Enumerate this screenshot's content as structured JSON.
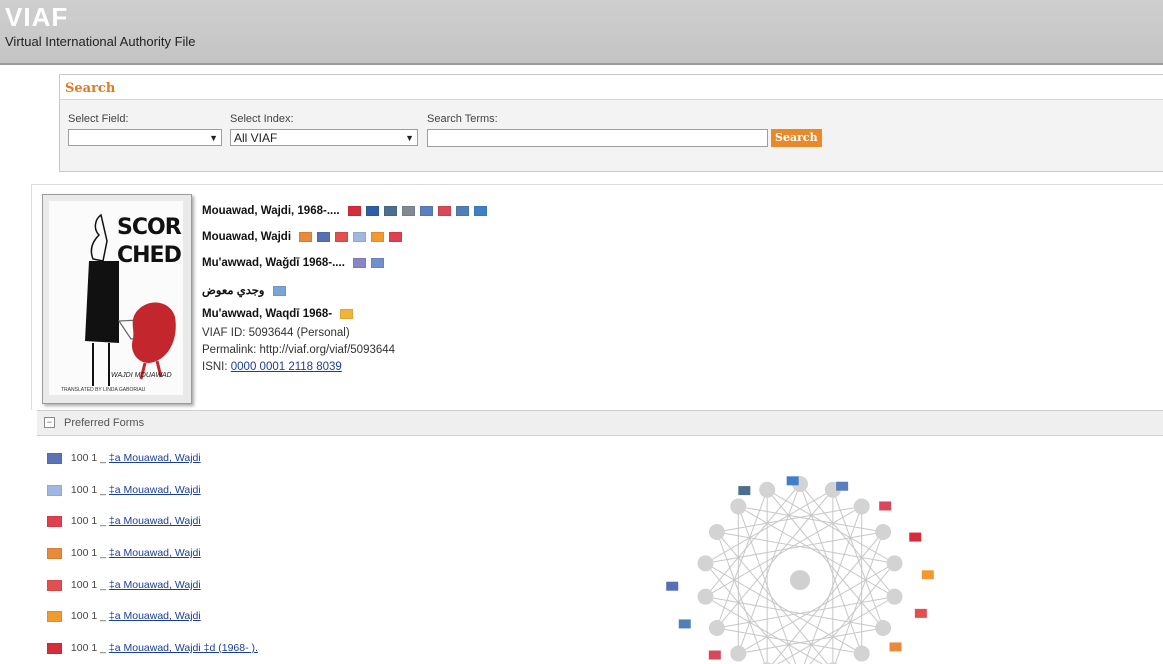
{
  "header": {
    "logo": "VIAF",
    "tagline": "Virtual International Authority File"
  },
  "search": {
    "title": "Search",
    "field_label": "Select Field:",
    "field_value": "",
    "index_label": "Select Index:",
    "index_value": "All VIAF",
    "terms_label": "Search Terms:",
    "terms_value": "",
    "button": "Search"
  },
  "cover": {
    "title_line1": "SCOR",
    "title_line2": "CHED",
    "author": "WAJDI MOUAWAD",
    "translator": "TRANSLATED BY LINDA GABORIAU"
  },
  "record": {
    "names": [
      {
        "text": "Mouawad, Wajdi, 1968-....",
        "flags": [
          "#d62d3b",
          "#2f5ea8",
          "#4a6f8f",
          "#7f8a95",
          "#5a7fbf",
          "#d9475a",
          "#4f7fb5",
          "#3f7fc9"
        ]
      },
      {
        "text": "Mouawad, Wajdi",
        "flags": [
          "#e88a3a",
          "#5570b4",
          "#e34f4f",
          "#9fb7e2",
          "#f19a2e",
          "#e0404e"
        ]
      },
      {
        "text": "Mu'awwad, Waǧdī 1968-....",
        "flags": [
          "#8a84c9",
          "#6f8fcf"
        ]
      },
      {
        "text": "وجدي معوض",
        "flags": [
          "#7aa3d6"
        ]
      },
      {
        "text": "Mu'awwad, Waqdī 1968-",
        "flags": [
          "#f2b33a"
        ]
      }
    ],
    "viaf_id": "VIAF ID: 5093644 (Personal)",
    "permalink": "Permalink: http://viaf.org/viaf/5093644",
    "isni_label": "ISNI:",
    "isni_value": "0000 0001 2118 8039"
  },
  "preferred_forms": {
    "label": "Preferred Forms",
    "rows": [
      {
        "tag": "100 1 _",
        "link": "‡a  Mouawad, Wajdi",
        "flag": "#5a73b8"
      },
      {
        "tag": "100 1 _",
        "link": "‡a  Mouawad, Wajdi",
        "flag": "#9fb7e2"
      },
      {
        "tag": "100 1 _",
        "link": "‡a  Mouawad, Wajdi",
        "flag": "#e0404e"
      },
      {
        "tag": "100 1 _",
        "link": "‡a  Mouawad, Wajdi",
        "flag": "#e88a3a"
      },
      {
        "tag": "100 1 _",
        "link": "‡a  Mouawad, Wajdi",
        "flag": "#e34f4f"
      },
      {
        "tag": "100 1 _",
        "link": "‡a  Mouawad, Wajdi",
        "flag": "#f19a2e"
      },
      {
        "tag": "100 1 _",
        "link": "‡a  Mouawad, Wajdi ‡d  (1968- ).",
        "flag": "#d62d3b"
      }
    ]
  },
  "network_flags": [
    "#4a6f8f",
    "#3f7fc9",
    "#5a7fbf",
    "#d9475a",
    "#d62d3b",
    "#f19a2e",
    "#e34f4f",
    "#e88a3a",
    "#e0404e",
    "#f2b33a",
    "#7f8a95",
    "#d9475a",
    "#4f7fb5",
    "#5570b4"
  ]
}
